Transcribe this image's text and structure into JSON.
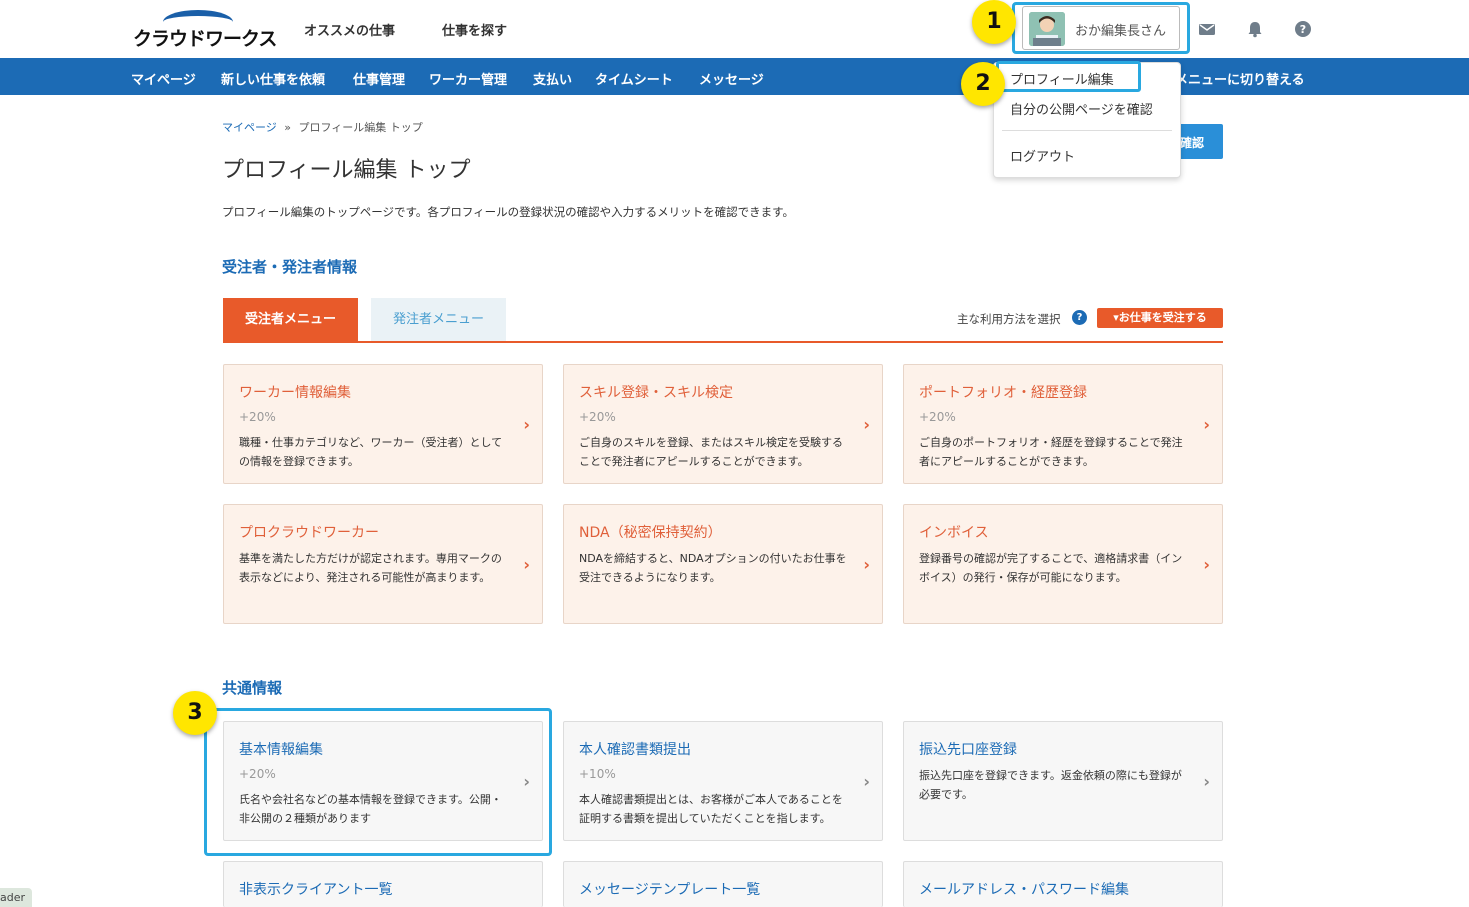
{
  "header": {
    "logo_text": "クラウドワークス",
    "nav": [
      "オススメの仕事",
      "仕事を探す"
    ],
    "user_name": "おか編集長さん"
  },
  "bluenav": {
    "items": [
      "マイページ",
      "新しい仕事を依頼",
      "仕事管理",
      "ワーカー管理",
      "支払い",
      "タイムシート",
      "メッセージ"
    ],
    "right_item": "メニューに切り替える"
  },
  "dropdown": {
    "items": [
      "プロフィール編集",
      "自分の公開ページを確認",
      "ログアウト"
    ]
  },
  "badges": [
    "1",
    "2",
    "3"
  ],
  "breadcrumb": {
    "home": "マイページ",
    "sep": "»",
    "current": "プロフィール編集 トップ"
  },
  "page": {
    "title": "プロフィール編集 トップ",
    "description": "プロフィール編集のトップページです。各プロフィールの登録状況の確認や入力するメリットを確認できます。",
    "blue_button_fragment": "確認"
  },
  "section1": {
    "title": "受注者・発注者情報",
    "tab_active": "受注者メニュー",
    "tab_inactive": "発注者メニュー",
    "usage_label": "主な利用方法を選択",
    "usage_select": "▾お仕事を受注する",
    "cards": [
      {
        "title": "ワーカー情報編集",
        "pct": "+20%",
        "desc": "職種・仕事カテゴリなど、ワーカー（受注者）としての情報を登録できます。"
      },
      {
        "title": "スキル登録・スキル検定",
        "pct": "+20%",
        "desc": "ご自身のスキルを登録、またはスキル検定を受験することで発注者にアピールすることができます。"
      },
      {
        "title": "ポートフォリオ・経歴登録",
        "pct": "+20%",
        "desc": "ご自身のポートフォリオ・経歴を登録することで発注者にアピールすることができます。"
      },
      {
        "title": "プロクラウドワーカー",
        "pct": "",
        "desc": "基準を満たした方だけが認定されます。専用マークの表示などにより、発注される可能性が高まります。"
      },
      {
        "title": "NDA（秘密保持契約）",
        "pct": "",
        "desc": "NDAを締結すると、NDAオプションの付いたお仕事を受注できるようになります。"
      },
      {
        "title": "インボイス",
        "pct": "",
        "desc": "登録番号の確認が完了することで、適格請求書（インボイス）の発行・保存が可能になります。"
      }
    ]
  },
  "section2": {
    "title": "共通情報",
    "cards": [
      {
        "title": "基本情報編集",
        "pct": "+20%",
        "desc": "氏名や会社名などの基本情報を登録できます。公開・非公開の２種類があります"
      },
      {
        "title": "本人確認書類提出",
        "pct": "+10%",
        "desc": "本人確認書類提出とは、お客様がご本人であることを証明する書類を提出していただくことを指します。"
      },
      {
        "title": "振込先口座登録",
        "pct": "",
        "desc": "振込先口座を登録できます。返金依頼の際にも登録が必要です。"
      },
      {
        "title": "非表示クライアント一覧",
        "pct": "",
        "desc": ""
      },
      {
        "title": "メッセージテンプレート一覧",
        "pct": "",
        "desc": ""
      },
      {
        "title": "メールアドレス・パスワード編集",
        "pct": "",
        "desc": ""
      }
    ]
  },
  "reader_tab": "ader",
  "icons": [
    "mail-icon",
    "bell-icon",
    "help-icon",
    "chevron-right-icon",
    "question-icon"
  ]
}
